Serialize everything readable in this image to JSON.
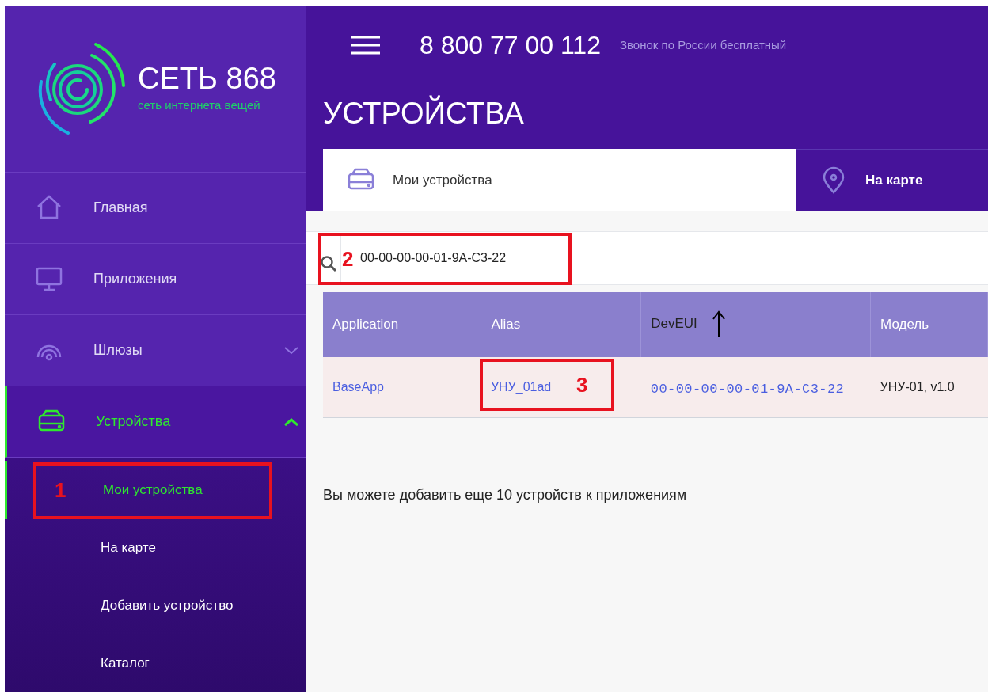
{
  "logo": {
    "name": "СЕТЬ 868",
    "tagline": "сеть интернета вещей"
  },
  "sidebar": {
    "items": [
      {
        "kind": "home",
        "label": "Главная",
        "selected": false
      },
      {
        "kind": "monitor",
        "label": "Приложения",
        "selected": false
      },
      {
        "kind": "gateway",
        "label": "Шлюзы",
        "selected": false,
        "expanded": false
      },
      {
        "kind": "device",
        "label": "Устройства",
        "selected": true,
        "expanded": true,
        "children": [
          {
            "label": "Мои устройства",
            "selected": true,
            "callout": "1"
          },
          {
            "label": "На карте",
            "selected": false
          },
          {
            "label": "Добавить устройство",
            "selected": false
          },
          {
            "label": "Каталог",
            "selected": false
          }
        ]
      }
    ]
  },
  "header": {
    "phone": "8 800 77 00 112",
    "phone_note": "Звонок по России бесплатный",
    "title": "УСТРОЙСТВА"
  },
  "tabs": [
    {
      "kind": "device",
      "label": "Мои устройства",
      "selected": true
    },
    {
      "kind": "pin",
      "label": "На карте",
      "selected": false
    }
  ],
  "search": {
    "value": "00-00-00-00-01-9A-C3-22",
    "callout": "2"
  },
  "table": {
    "columns": [
      {
        "label": "Application"
      },
      {
        "label": "Alias"
      },
      {
        "label": "DevEUI",
        "sorted": true
      },
      {
        "label": "Модель"
      }
    ],
    "rows": [
      {
        "cells": [
          {
            "text": "BaseApp",
            "kind": "link"
          },
          {
            "text": "УНУ_01ad",
            "kind": "link",
            "callout": "3"
          },
          {
            "text": "00-00-00-00-01-9A-C3-22",
            "kind": "code"
          },
          {
            "text": "УНУ-01, v1.0",
            "kind": "text"
          }
        ]
      }
    ]
  },
  "note": "Вы можете добавить еще 10 устройств к приложениям"
}
